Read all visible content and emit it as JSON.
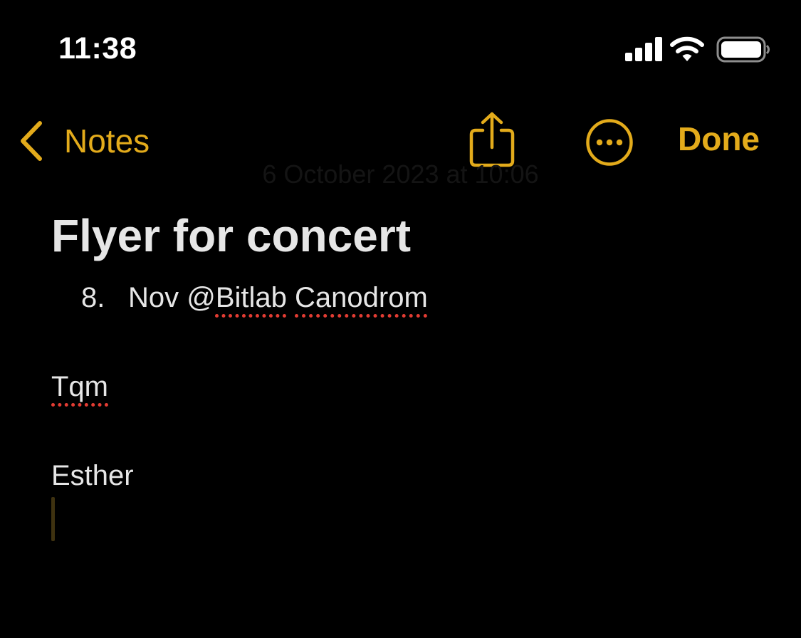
{
  "status_bar": {
    "time": "11:38",
    "icons": [
      "cellular-signal-icon",
      "wifi-icon",
      "battery-icon"
    ]
  },
  "nav": {
    "back_label": "Notes",
    "done_label": "Done",
    "icons": {
      "back": "chevron-left-icon",
      "share": "share-icon",
      "more": "more-ellipsis-icon"
    },
    "accent_color": "#e3ab1b"
  },
  "note": {
    "date": "6 October 2023 at 10:06",
    "title": "Flyer for concert",
    "list_item": {
      "number": "8.",
      "text_prefix": "Nov @",
      "word_1": "Bitlab",
      "word_2": "Canodrom"
    },
    "paragraph_1": "Tqm",
    "paragraph_2": "Esther"
  },
  "colors": {
    "background": "#000000",
    "text": "#e6e6e6",
    "spellcheck_underline": "#e23c33"
  }
}
